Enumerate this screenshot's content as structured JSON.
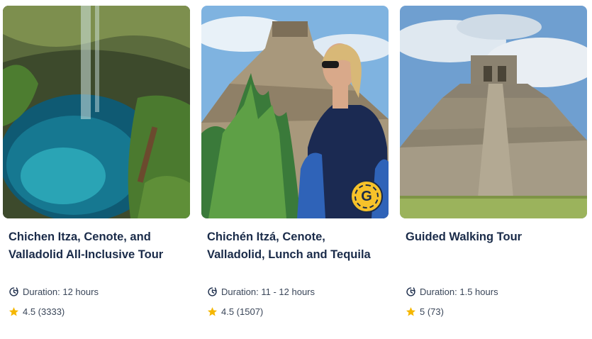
{
  "cards": [
    {
      "title": "Chichen Itza, Cenote, and Valladolid All-Inclusive Tour",
      "duration": "Duration: 12 hours",
      "rating": "4.5 (3333)",
      "image": "cenote-waterfall-photo"
    },
    {
      "title": "Chichén Itzá, Cenote, Valladolid, Lunch and Tequila",
      "duration": "Duration: 11 - 12 hours",
      "rating": "4.5 (1507)",
      "image": "woman-at-pyramid-photo",
      "badge": "G"
    },
    {
      "title": "Guided Walking Tour",
      "duration": "Duration: 1.5 hours",
      "rating": "5 (73)",
      "image": "kukulcan-pyramid-photo"
    }
  ],
  "icons": {
    "duration": "clock-icon",
    "rating": "star-icon"
  },
  "colors": {
    "title": "#1a2b49",
    "meta": "#3a4659",
    "star": "#f5b700",
    "badge": "#f6c22a"
  }
}
